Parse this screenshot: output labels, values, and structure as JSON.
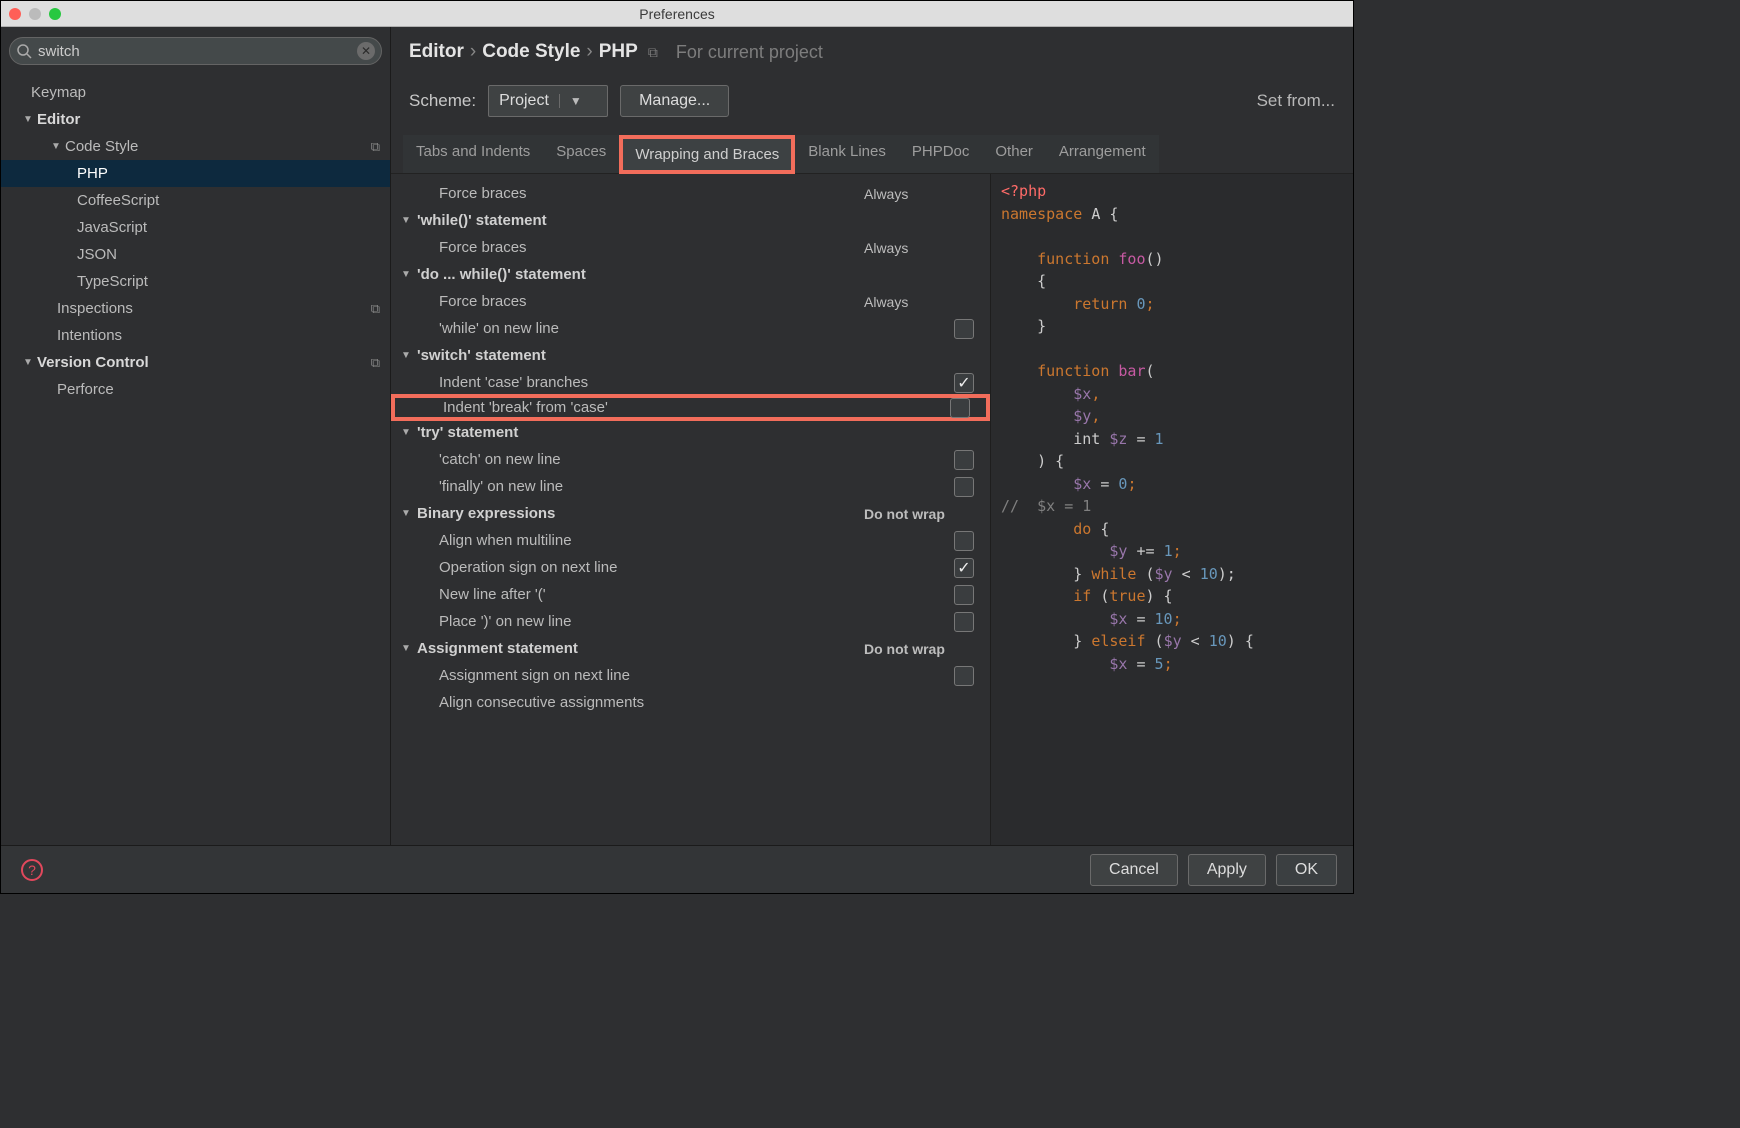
{
  "window": {
    "title": "Preferences"
  },
  "search": {
    "value": "switch"
  },
  "sidebar_tree": {
    "keymap": "Keymap",
    "editor": "Editor",
    "code_style": "Code Style",
    "php": "PHP",
    "coffee": "CoffeeScript",
    "js": "JavaScript",
    "json": "JSON",
    "ts": "TypeScript",
    "inspections": "Inspections",
    "intentions": "Intentions",
    "vcs": "Version Control",
    "perforce": "Perforce"
  },
  "breadcrumb": {
    "a": "Editor",
    "b": "Code Style",
    "c": "PHP",
    "hint": "For current project"
  },
  "scheme": {
    "label": "Scheme:",
    "value": "Project",
    "manage": "Manage...",
    "set_from": "Set from..."
  },
  "tabs": {
    "t0": "Tabs and Indents",
    "t1": "Spaces",
    "t2": "Wrapping and Braces",
    "t3": "Blank Lines",
    "t4": "PHPDoc",
    "t5": "Other",
    "t6": "Arrangement"
  },
  "rows": {
    "force_braces_1": {
      "label": "Force braces",
      "value": "Always"
    },
    "while_stmt": {
      "label": "'while()' statement"
    },
    "force_braces_2": {
      "label": "Force braces",
      "value": "Always"
    },
    "do_while_stmt": {
      "label": "'do ... while()' statement"
    },
    "force_braces_3": {
      "label": "Force braces",
      "value": "Always"
    },
    "while_newline": {
      "label": "'while' on new line",
      "checked": false
    },
    "switch_stmt": {
      "label": "'switch' statement"
    },
    "indent_case": {
      "label": "Indent 'case' branches",
      "checked": true
    },
    "indent_break": {
      "label": "Indent 'break' from 'case'",
      "checked": false
    },
    "try_stmt": {
      "label": "'try' statement"
    },
    "catch_newline": {
      "label": "'catch' on new line",
      "checked": false
    },
    "finally_newline": {
      "label": "'finally' on new line",
      "checked": false
    },
    "binary_expr": {
      "label": "Binary expressions",
      "value": "Do not wrap"
    },
    "align_multiline": {
      "label": "Align when multiline",
      "checked": false
    },
    "op_sign_next": {
      "label": "Operation sign on next line",
      "checked": true
    },
    "newline_after_paren": {
      "label": "New line after '('",
      "checked": false
    },
    "place_paren_newline": {
      "label": "Place ')' on new line",
      "checked": false
    },
    "assign_stmt": {
      "label": "Assignment statement",
      "value": "Do not wrap"
    },
    "assign_sign_next": {
      "label": "Assignment sign on next line",
      "checked": false
    },
    "align_consec": {
      "label": "Align consecutive assignments"
    }
  },
  "footer": {
    "cancel": "Cancel",
    "apply": "Apply",
    "ok": "OK"
  },
  "code": {
    "l1a": "<?php",
    "l2a": "namespace ",
    "l2b": "A {",
    "l3a": "    function ",
    "l3b": "foo",
    "l3c": "()",
    "l4": "    {",
    "l5a": "        return ",
    "l5b": "0",
    "l5c": ";",
    "l6": "    }",
    "l7a": "    function ",
    "l7b": "bar",
    "l7c": "(",
    "l8a": "        $x",
    "l8b": ",",
    "l9a": "        $y",
    "l9b": ",",
    "l10a": "        int ",
    "l10b": "$z ",
    "l10c": "= ",
    "l10d": "1",
    "l11": "    ) {",
    "l12a": "        $x ",
    "l12b": "= ",
    "l12c": "0",
    "l12d": ";",
    "l13": "//  $x = 1",
    "l14a": "        do ",
    "l14b": "{",
    "l15a": "            $y ",
    "l15b": "+= ",
    "l15c": "1",
    "l15d": ";",
    "l16a": "        } ",
    "l16b": "while ",
    "l16c": "(",
    "l16d": "$y ",
    "l16e": "< ",
    "l16f": "10",
    "l16g": ");",
    "l17a": "        if ",
    "l17b": "(",
    "l17c": "true",
    "l17d": ") {",
    "l18a": "            $x ",
    "l18b": "= ",
    "l18c": "10",
    "l18d": ";",
    "l19a": "        } ",
    "l19b": "elseif ",
    "l19c": "(",
    "l19d": "$y ",
    "l19e": "< ",
    "l19f": "10",
    "l19g": ") {",
    "l20a": "            $x ",
    "l20b": "= ",
    "l20c": "5",
    "l20d": ";"
  }
}
